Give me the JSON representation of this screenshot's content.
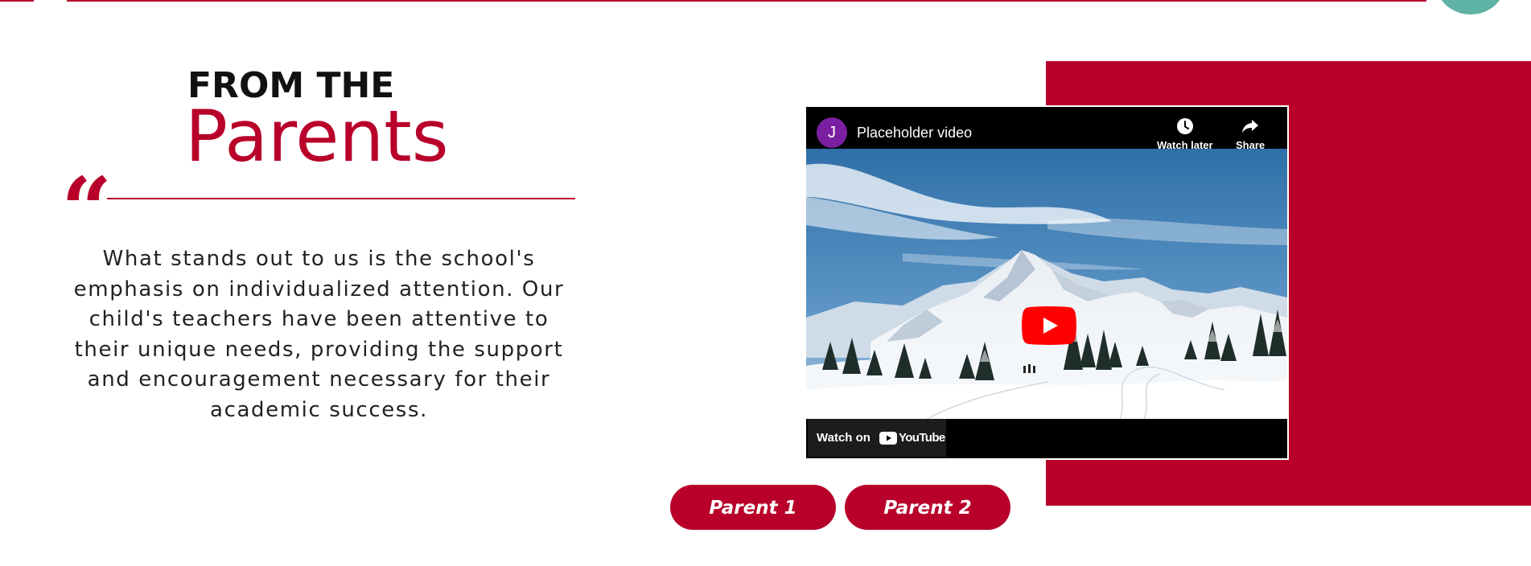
{
  "section": {
    "heading_small": "FROM THE",
    "heading_big": "Parents",
    "quote_mark": "“",
    "quote_text": "What stands out to us is the school's emphasis on individualized attention. Our child's teachers have been attentive to their unique needs, providing the support and encouragement necessary for their academic success."
  },
  "video": {
    "channel_initial": "J",
    "title": "Placeholder video",
    "watch_later_label": "Watch later",
    "share_label": "Share",
    "watch_on_label": "Watch on",
    "youtube_label": "YouTube"
  },
  "buttons": {
    "parent_1": "Parent 1",
    "parent_2": "Parent 2"
  },
  "colors": {
    "accent": "#b8002a",
    "teal": "#5fb3a6",
    "avatar": "#7b1fa2",
    "youtube_red": "#ff0000"
  },
  "icons": {
    "watch_later": "clock-icon",
    "share": "share-arrow-icon",
    "play": "play-icon",
    "youtube": "youtube-logo-icon",
    "quote": "quote-icon"
  }
}
